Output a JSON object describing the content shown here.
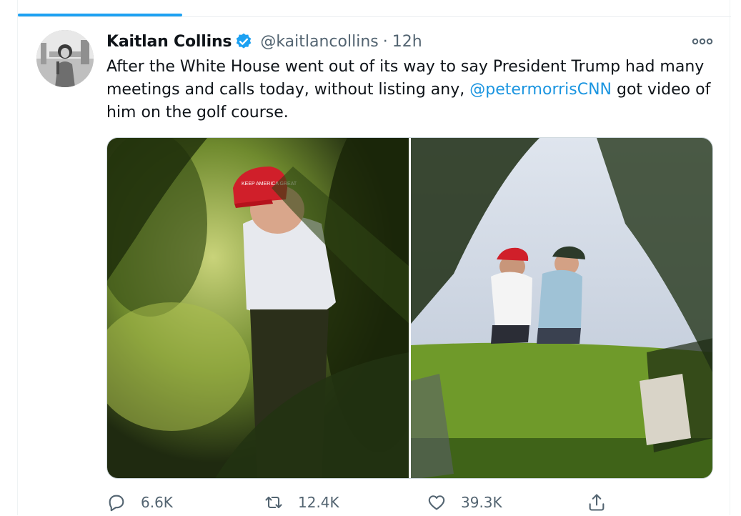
{
  "tweet": {
    "author_name": "Kaitlan Collins",
    "author_handle": "@kaitlancollins",
    "separator": "·",
    "time": "12h",
    "text_before": "After the White House went out of its way to say President Trump had many meetings and calls today, without listing any, ",
    "mention": "@petermorrisCNN",
    "text_after": " got video of him on the golf course.",
    "verified_icon": "verified-badge-icon",
    "more_icon": "more-options-icon",
    "cap_text": "KEEP AMERICA GREAT",
    "colors": {
      "accent": "#1da1f2",
      "mention": "#1b95e0",
      "text": "#0f1419",
      "secondary": "#536471"
    }
  },
  "actions": {
    "reply_count": "6.6K",
    "retweet_count": "12.4K",
    "like_count": "39.3K",
    "reply_icon": "reply-icon",
    "retweet_icon": "retweet-icon",
    "like_icon": "heart-icon",
    "share_icon": "share-icon"
  }
}
